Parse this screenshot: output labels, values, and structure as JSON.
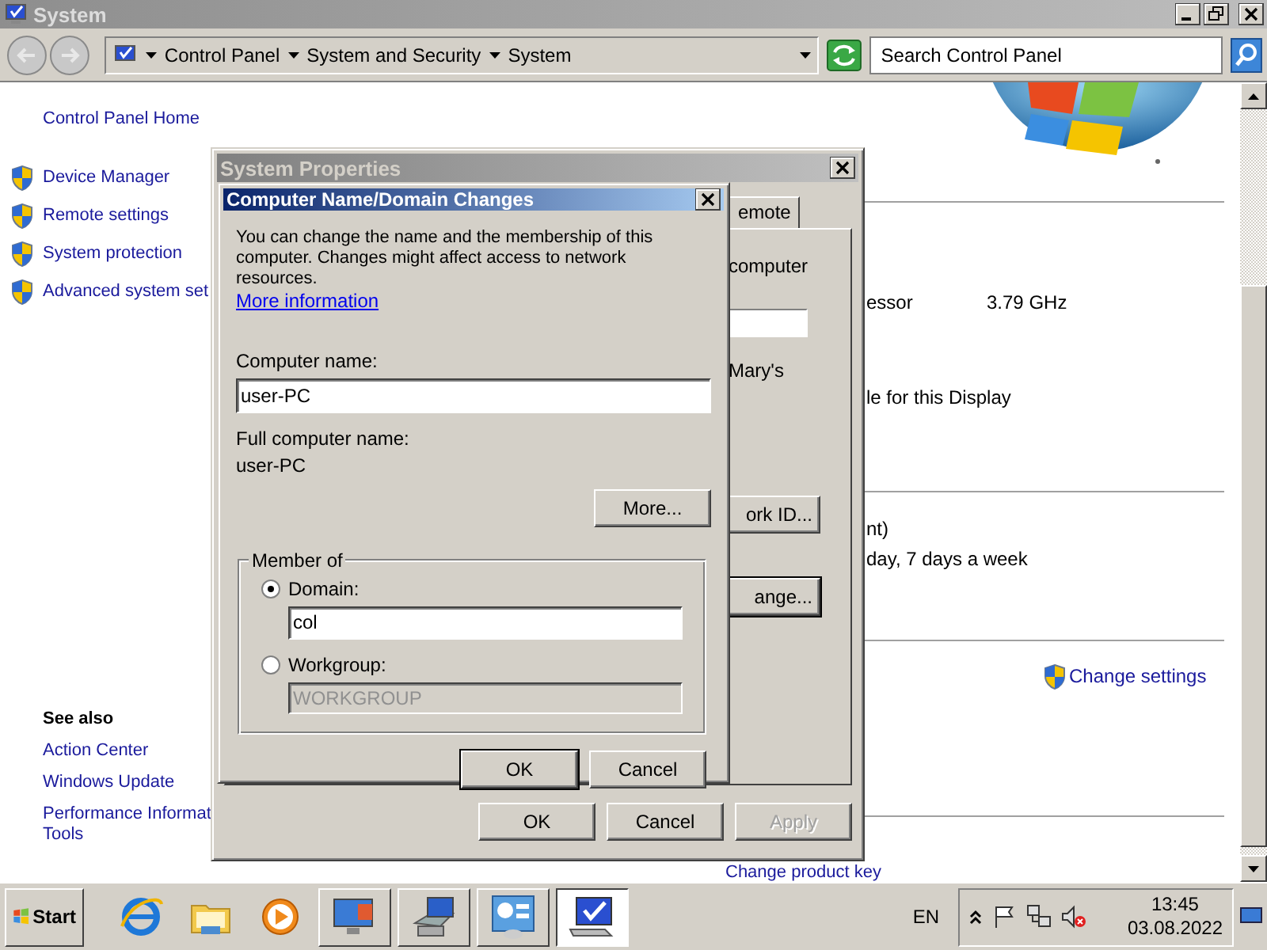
{
  "window": {
    "title": "System"
  },
  "address_bar": {
    "breadcrumbs": [
      "Control Panel",
      "System and Security",
      "System"
    ],
    "search": {
      "placeholder": "Search Control Panel"
    }
  },
  "sidebar": {
    "home": "Control Panel Home",
    "tasks": [
      "Device Manager",
      "Remote settings",
      "System protection",
      "Advanced system set"
    ],
    "see_also": {
      "heading": "See also",
      "links": [
        {
          "lines": [
            "Action Center"
          ]
        },
        {
          "lines": [
            "Windows Update"
          ]
        },
        {
          "lines": [
            "Performance Informat",
            "Tools"
          ]
        }
      ]
    }
  },
  "content": {
    "sections": [
      {
        "lines": [
          {
            "label": "essor",
            "value": "3.79 GHz"
          },
          {
            "label": "le for this Display"
          }
        ]
      },
      {
        "lines": [
          {
            "label": "nt)"
          },
          {
            "label": "day, 7 days a week"
          }
        ]
      },
      {
        "link": "Change settings"
      }
    ],
    "product_key_link": "Change product key"
  },
  "system_properties": {
    "title": "System Properties",
    "tabs": [
      {
        "label": "emote",
        "selected": false
      }
    ],
    "panel": {
      "texts": [
        "computer",
        "Mary's"
      ],
      "buttons": [
        {
          "label": "ork ID...",
          "default": false
        },
        {
          "label": "ange...",
          "default": true
        }
      ]
    },
    "buttons": [
      {
        "label": "OK",
        "disabled": false
      },
      {
        "label": "Cancel",
        "disabled": false
      },
      {
        "label": "Apply",
        "disabled": true
      }
    ]
  },
  "name_dialog": {
    "title": "Computer Name/Domain Changes",
    "description": "You can change the name and the membership of this computer. Changes might affect access to network resources.",
    "link": "More information",
    "computer_name_label": "Computer name:",
    "computer_name": "user-PC",
    "full_name_label": "Full computer name:",
    "full_name": "user-PC",
    "more_button": "More...",
    "member_of": {
      "legend": "Member of",
      "options": [
        {
          "label": "Domain:",
          "selected": true,
          "value": "col"
        },
        {
          "label": "Workgroup:",
          "selected": false,
          "value": "WORKGROUP"
        }
      ]
    },
    "buttons": [
      {
        "label": "OK",
        "default": true
      },
      {
        "label": "Cancel",
        "default": false
      }
    ]
  },
  "taskbar": {
    "start": "Start",
    "pinned": [
      {
        "kind": "browser"
      },
      {
        "kind": "folder"
      },
      {
        "kind": "media"
      }
    ],
    "tasks": [
      {
        "kind": "display",
        "selected": false
      },
      {
        "kind": "server",
        "selected": false
      },
      {
        "kind": "panel",
        "selected": false
      },
      {
        "kind": "computer",
        "selected": true
      }
    ],
    "language": "EN",
    "time": "13:45",
    "date": "03.08.2022"
  }
}
